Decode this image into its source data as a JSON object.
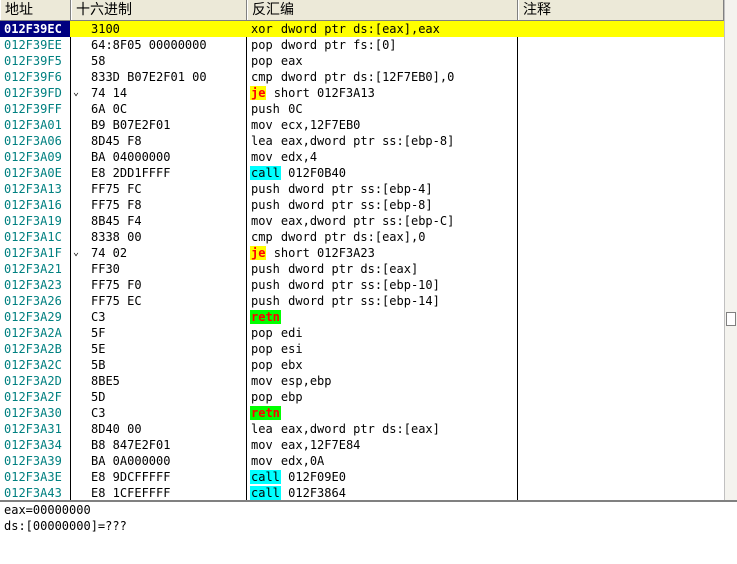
{
  "columns": {
    "addr": "地址",
    "hex": "十六进制",
    "disasm": "反汇编",
    "comment": "注释"
  },
  "rows": [
    {
      "addr": "012F39EC",
      "mark": "",
      "hex": "3100",
      "mn": "xor",
      "ops": "dword ptr ds:[eax],eax",
      "selected": true
    },
    {
      "addr": "012F39EE",
      "mark": "",
      "hex": "64:8F05 00000000",
      "mn": "pop",
      "ops": "dword ptr fs:[0]"
    },
    {
      "addr": "012F39F5",
      "mark": "",
      "hex": "58",
      "mn": "pop",
      "ops": "eax"
    },
    {
      "addr": "012F39F6",
      "mark": "",
      "hex": "833D B07E2F01 00",
      "mn": "cmp",
      "ops": "dword ptr ds:[12F7EB0],0"
    },
    {
      "addr": "012F39FD",
      "mark": "⌄",
      "hex": "74 14",
      "mn": "je",
      "ops": "short 012F3A13",
      "hl": "je"
    },
    {
      "addr": "012F39FF",
      "mark": "",
      "hex": "6A 0C",
      "mn": "push",
      "ops": "0C"
    },
    {
      "addr": "012F3A01",
      "mark": "",
      "hex": "B9 B07E2F01",
      "mn": "mov",
      "ops": "ecx,12F7EB0"
    },
    {
      "addr": "012F3A06",
      "mark": "",
      "hex": "8D45 F8",
      "mn": "lea",
      "ops": "eax,dword ptr ss:[ebp-8]"
    },
    {
      "addr": "012F3A09",
      "mark": "",
      "hex": "BA 04000000",
      "mn": "mov",
      "ops": "edx,4"
    },
    {
      "addr": "012F3A0E",
      "mark": "",
      "hex": "E8 2DD1FFFF",
      "mn": "call",
      "ops": "012F0B40",
      "hl": "call"
    },
    {
      "addr": "012F3A13",
      "mark": "",
      "hex": "FF75 FC",
      "mn": "push",
      "ops": "dword ptr ss:[ebp-4]"
    },
    {
      "addr": "012F3A16",
      "mark": "",
      "hex": "FF75 F8",
      "mn": "push",
      "ops": "dword ptr ss:[ebp-8]"
    },
    {
      "addr": "012F3A19",
      "mark": "",
      "hex": "8B45 F4",
      "mn": "mov",
      "ops": "eax,dword ptr ss:[ebp-C]"
    },
    {
      "addr": "012F3A1C",
      "mark": "",
      "hex": "8338 00",
      "mn": "cmp",
      "ops": "dword ptr ds:[eax],0"
    },
    {
      "addr": "012F3A1F",
      "mark": "⌄",
      "hex": "74 02",
      "mn": "je",
      "ops": "short 012F3A23",
      "hl": "je"
    },
    {
      "addr": "012F3A21",
      "mark": "",
      "hex": "FF30",
      "mn": "push",
      "ops": "dword ptr ds:[eax]"
    },
    {
      "addr": "012F3A23",
      "mark": "",
      "hex": "FF75 F0",
      "mn": "push",
      "ops": "dword ptr ss:[ebp-10]"
    },
    {
      "addr": "012F3A26",
      "mark": "",
      "hex": "FF75 EC",
      "mn": "push",
      "ops": "dword ptr ss:[ebp-14]"
    },
    {
      "addr": "012F3A29",
      "mark": "",
      "hex": "C3",
      "mn": "retn",
      "ops": "",
      "hl": "retn"
    },
    {
      "addr": "012F3A2A",
      "mark": "",
      "hex": "5F",
      "mn": "pop",
      "ops": "edi"
    },
    {
      "addr": "012F3A2B",
      "mark": "",
      "hex": "5E",
      "mn": "pop",
      "ops": "esi"
    },
    {
      "addr": "012F3A2C",
      "mark": "",
      "hex": "5B",
      "mn": "pop",
      "ops": "ebx"
    },
    {
      "addr": "012F3A2D",
      "mark": "",
      "hex": "8BE5",
      "mn": "mov",
      "ops": "esp,ebp"
    },
    {
      "addr": "012F3A2F",
      "mark": "",
      "hex": "5D",
      "mn": "pop",
      "ops": "ebp"
    },
    {
      "addr": "012F3A30",
      "mark": "",
      "hex": "C3",
      "mn": "retn",
      "ops": "",
      "hl": "retn"
    },
    {
      "addr": "012F3A31",
      "mark": "",
      "hex": "8D40 00",
      "mn": "lea",
      "ops": "eax,dword ptr ds:[eax]"
    },
    {
      "addr": "012F3A34",
      "mark": "",
      "hex": "B8 847E2F01",
      "mn": "mov",
      "ops": "eax,12F7E84"
    },
    {
      "addr": "012F3A39",
      "mark": "",
      "hex": "BA 0A000000",
      "mn": "mov",
      "ops": "edx,0A"
    },
    {
      "addr": "012F3A3E",
      "mark": "",
      "hex": "E8 9DCFFFFF",
      "mn": "call",
      "ops": "012F09E0",
      "hl": "call"
    },
    {
      "addr": "012F3A43",
      "mark": "",
      "hex": "E8 1CFEFFFF",
      "mn": "call",
      "ops": "012F3864",
      "hl": "call"
    }
  ],
  "info": {
    "line1": "eax=00000000",
    "line2": "ds:[00000000]=???"
  },
  "colors": {
    "selected_row": "#ffff00",
    "address": "#008080",
    "je_bg": "#ffff00",
    "call_bg": "#00ffff",
    "retn_bg": "#00ff00"
  }
}
